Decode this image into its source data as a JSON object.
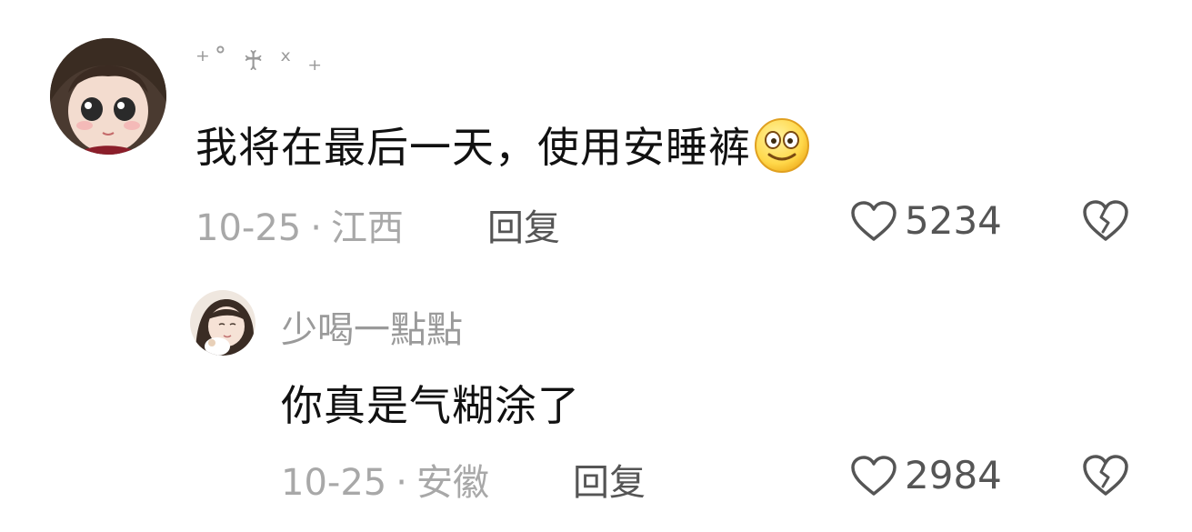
{
  "comments": [
    {
      "username": "⁺˚ ♰ ˣ ₊",
      "text": "我将在最后一天，使用安睡裤",
      "emoji": "smiling-face-emoji",
      "date": "10-25",
      "separator": "·",
      "location": "江西",
      "reply_label": "回复",
      "likes": "5234"
    },
    {
      "username": "少喝一點點",
      "text": "你真是气糊涂了",
      "date": "10-25",
      "separator": "·",
      "location": "安徽",
      "reply_label": "回复",
      "likes": "2984"
    }
  ],
  "icons": {
    "like": "heart-outline-icon",
    "dislike": "broken-heart-icon"
  },
  "colors": {
    "primary_text": "#111111",
    "secondary_text": "#9a9a9a",
    "action_text": "#555555"
  }
}
